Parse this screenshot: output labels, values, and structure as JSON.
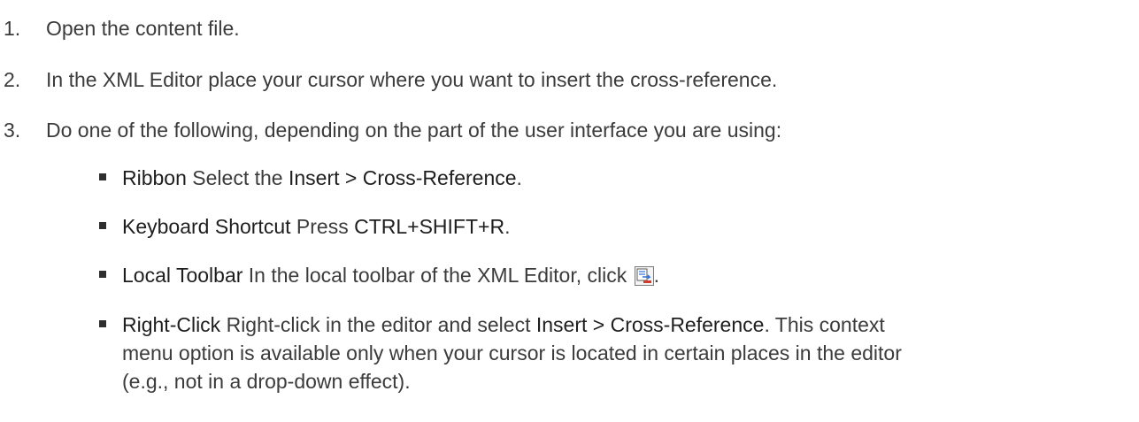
{
  "steps": [
    {
      "num": "1.",
      "text": "Open the content file."
    },
    {
      "num": "2.",
      "text": "In the XML Editor place your cursor where you want to insert the cross-reference."
    },
    {
      "num": "3.",
      "text": "Do one of the following, depending on the part of the user interface you are using:"
    }
  ],
  "options": {
    "ribbon": {
      "label": "Ribbon",
      "pre": " Select the ",
      "command": "Insert > Cross-Reference",
      "post": "."
    },
    "keyboard": {
      "label": "Keyboard Shortcut",
      "pre": " Press ",
      "command": "CTRL+SHIFT+R",
      "post": "."
    },
    "toolbar": {
      "label": "Local Toolbar",
      "pre": " In the local toolbar of the XML Editor, click ",
      "icon": "insert-cross-reference-icon",
      "post": "."
    },
    "rightclick": {
      "label": "Right-Click",
      "pre": " Right-click in the editor and select ",
      "command": "Insert > Cross-Reference",
      "post": ". This context",
      "line2": "menu option is available only when your cursor is located in certain places in the editor",
      "line3": "(e.g., not in a drop-down effect)."
    }
  },
  "colors": {
    "text": "#3b3b3b",
    "emphasis": "#1e1e1e",
    "icon_blue": "#2f6fd0",
    "icon_red": "#d23a2a"
  }
}
